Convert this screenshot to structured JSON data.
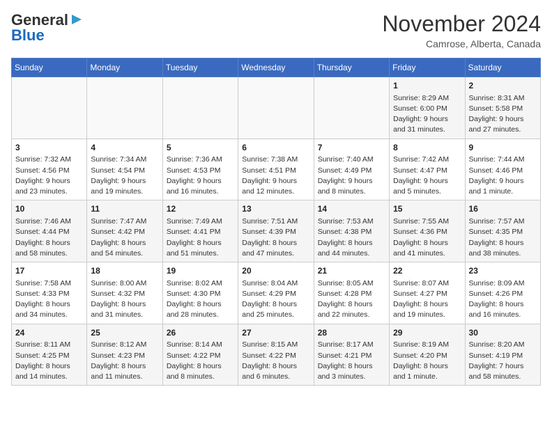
{
  "header": {
    "logo_general": "General",
    "logo_blue": "Blue",
    "month_title": "November 2024",
    "location": "Camrose, Alberta, Canada"
  },
  "days_of_week": [
    "Sunday",
    "Monday",
    "Tuesday",
    "Wednesday",
    "Thursday",
    "Friday",
    "Saturday"
  ],
  "weeks": [
    [
      {
        "day": "",
        "info": ""
      },
      {
        "day": "",
        "info": ""
      },
      {
        "day": "",
        "info": ""
      },
      {
        "day": "",
        "info": ""
      },
      {
        "day": "",
        "info": ""
      },
      {
        "day": "1",
        "info": "Sunrise: 8:29 AM\nSunset: 6:00 PM\nDaylight: 9 hours and 31 minutes."
      },
      {
        "day": "2",
        "info": "Sunrise: 8:31 AM\nSunset: 5:58 PM\nDaylight: 9 hours and 27 minutes."
      }
    ],
    [
      {
        "day": "3",
        "info": "Sunrise: 7:32 AM\nSunset: 4:56 PM\nDaylight: 9 hours and 23 minutes."
      },
      {
        "day": "4",
        "info": "Sunrise: 7:34 AM\nSunset: 4:54 PM\nDaylight: 9 hours and 19 minutes."
      },
      {
        "day": "5",
        "info": "Sunrise: 7:36 AM\nSunset: 4:53 PM\nDaylight: 9 hours and 16 minutes."
      },
      {
        "day": "6",
        "info": "Sunrise: 7:38 AM\nSunset: 4:51 PM\nDaylight: 9 hours and 12 minutes."
      },
      {
        "day": "7",
        "info": "Sunrise: 7:40 AM\nSunset: 4:49 PM\nDaylight: 9 hours and 8 minutes."
      },
      {
        "day": "8",
        "info": "Sunrise: 7:42 AM\nSunset: 4:47 PM\nDaylight: 9 hours and 5 minutes."
      },
      {
        "day": "9",
        "info": "Sunrise: 7:44 AM\nSunset: 4:46 PM\nDaylight: 9 hours and 1 minute."
      }
    ],
    [
      {
        "day": "10",
        "info": "Sunrise: 7:46 AM\nSunset: 4:44 PM\nDaylight: 8 hours and 58 minutes."
      },
      {
        "day": "11",
        "info": "Sunrise: 7:47 AM\nSunset: 4:42 PM\nDaylight: 8 hours and 54 minutes."
      },
      {
        "day": "12",
        "info": "Sunrise: 7:49 AM\nSunset: 4:41 PM\nDaylight: 8 hours and 51 minutes."
      },
      {
        "day": "13",
        "info": "Sunrise: 7:51 AM\nSunset: 4:39 PM\nDaylight: 8 hours and 47 minutes."
      },
      {
        "day": "14",
        "info": "Sunrise: 7:53 AM\nSunset: 4:38 PM\nDaylight: 8 hours and 44 minutes."
      },
      {
        "day": "15",
        "info": "Sunrise: 7:55 AM\nSunset: 4:36 PM\nDaylight: 8 hours and 41 minutes."
      },
      {
        "day": "16",
        "info": "Sunrise: 7:57 AM\nSunset: 4:35 PM\nDaylight: 8 hours and 38 minutes."
      }
    ],
    [
      {
        "day": "17",
        "info": "Sunrise: 7:58 AM\nSunset: 4:33 PM\nDaylight: 8 hours and 34 minutes."
      },
      {
        "day": "18",
        "info": "Sunrise: 8:00 AM\nSunset: 4:32 PM\nDaylight: 8 hours and 31 minutes."
      },
      {
        "day": "19",
        "info": "Sunrise: 8:02 AM\nSunset: 4:30 PM\nDaylight: 8 hours and 28 minutes."
      },
      {
        "day": "20",
        "info": "Sunrise: 8:04 AM\nSunset: 4:29 PM\nDaylight: 8 hours and 25 minutes."
      },
      {
        "day": "21",
        "info": "Sunrise: 8:05 AM\nSunset: 4:28 PM\nDaylight: 8 hours and 22 minutes."
      },
      {
        "day": "22",
        "info": "Sunrise: 8:07 AM\nSunset: 4:27 PM\nDaylight: 8 hours and 19 minutes."
      },
      {
        "day": "23",
        "info": "Sunrise: 8:09 AM\nSunset: 4:26 PM\nDaylight: 8 hours and 16 minutes."
      }
    ],
    [
      {
        "day": "24",
        "info": "Sunrise: 8:11 AM\nSunset: 4:25 PM\nDaylight: 8 hours and 14 minutes."
      },
      {
        "day": "25",
        "info": "Sunrise: 8:12 AM\nSunset: 4:23 PM\nDaylight: 8 hours and 11 minutes."
      },
      {
        "day": "26",
        "info": "Sunrise: 8:14 AM\nSunset: 4:22 PM\nDaylight: 8 hours and 8 minutes."
      },
      {
        "day": "27",
        "info": "Sunrise: 8:15 AM\nSunset: 4:22 PM\nDaylight: 8 hours and 6 minutes."
      },
      {
        "day": "28",
        "info": "Sunrise: 8:17 AM\nSunset: 4:21 PM\nDaylight: 8 hours and 3 minutes."
      },
      {
        "day": "29",
        "info": "Sunrise: 8:19 AM\nSunset: 4:20 PM\nDaylight: 8 hours and 1 minute."
      },
      {
        "day": "30",
        "info": "Sunrise: 8:20 AM\nSunset: 4:19 PM\nDaylight: 7 hours and 58 minutes."
      }
    ]
  ]
}
